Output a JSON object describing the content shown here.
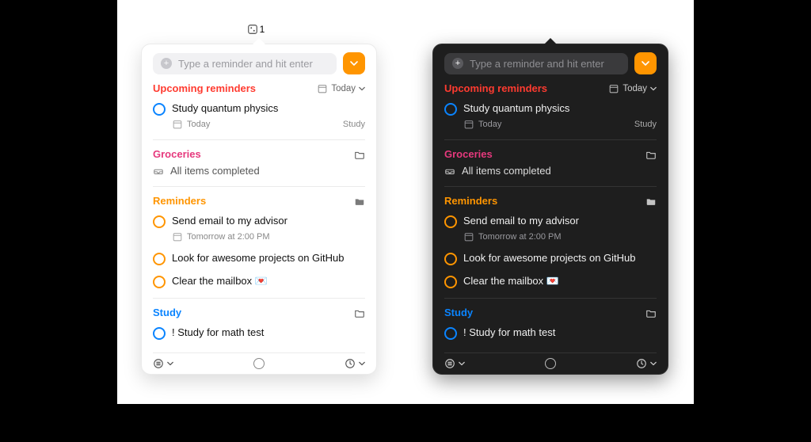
{
  "menubar": {
    "badge": "1"
  },
  "input": {
    "placeholder": "Type a reminder and hit enter"
  },
  "sections": {
    "upcoming": {
      "title": "Upcoming reminders",
      "filter_prefix": "Today",
      "items": [
        {
          "title": "Study quantum physics",
          "due": "Today",
          "tag": "Study"
        }
      ]
    },
    "groceries": {
      "title": "Groceries",
      "completed_text": "All items completed"
    },
    "reminders": {
      "title": "Reminders",
      "items": [
        {
          "title": "Send email to my advisor",
          "due": "Tomorrow at 2:00 PM"
        },
        {
          "title": "Look for awesome projects on GitHub"
        },
        {
          "title": "Clear the mailbox 💌"
        }
      ]
    },
    "study": {
      "title": "Study",
      "items": [
        {
          "title": "! Study for math test"
        }
      ]
    }
  }
}
